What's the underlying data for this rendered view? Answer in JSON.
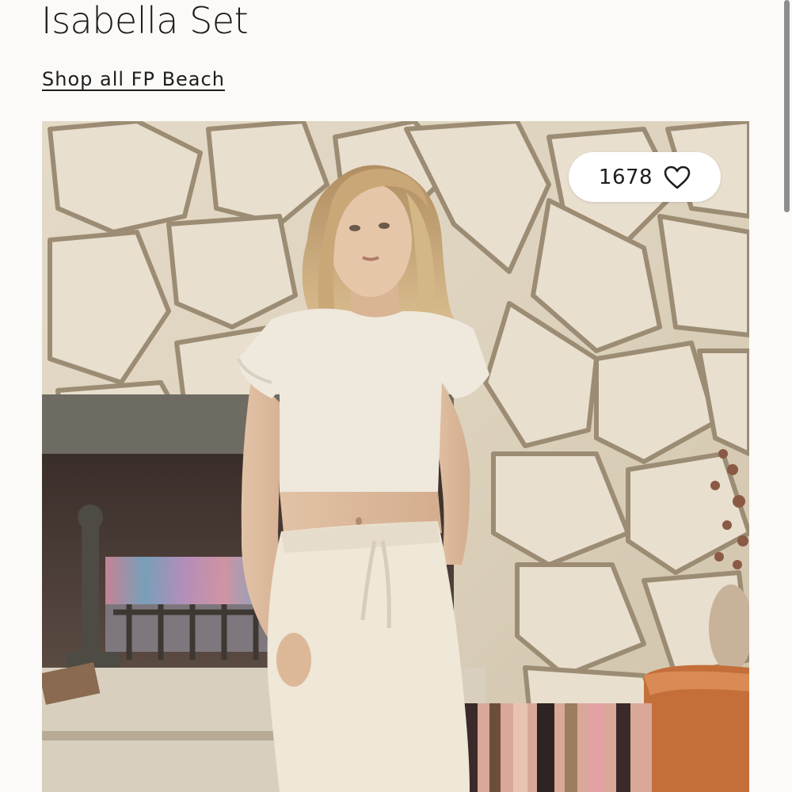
{
  "product": {
    "title": "Isabella Set",
    "shop_link_label": "Shop all FP Beach"
  },
  "like_button": {
    "count": "1678",
    "icon": "heart-outline-icon"
  },
  "image": {
    "alt": "Isabella Set"
  },
  "colors": {
    "background": "#fcfaf8",
    "text": "#1d1d1d",
    "pill_background": "#ffffff",
    "scrollbar": "#8d8d8d"
  }
}
